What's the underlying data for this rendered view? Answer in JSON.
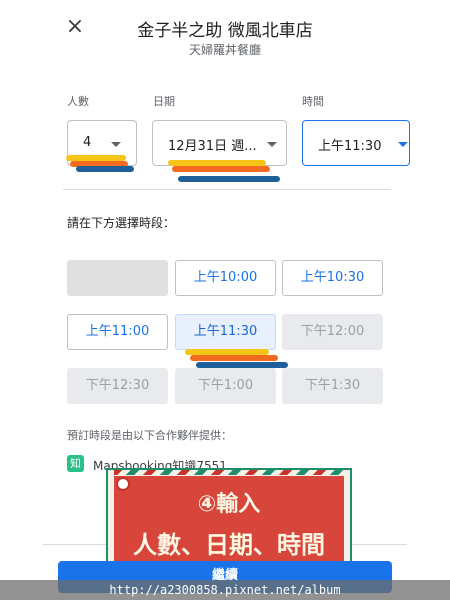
{
  "header": {
    "close_icon": "×",
    "title": "金子半之助 微風北車店",
    "subtitle": "天婦羅丼餐廳"
  },
  "booking": {
    "party_label": "人數",
    "party_value": "4",
    "date_label": "日期",
    "date_value": "12月31日 週...",
    "time_label": "時間",
    "time_value": "上午11:30"
  },
  "slots_heading": "請在下方選擇時段：",
  "slots": [
    {
      "label": "",
      "state": "empty"
    },
    {
      "label": "上午10:00",
      "state": "available"
    },
    {
      "label": "上午10:30",
      "state": "available"
    },
    {
      "label": "上午11:00",
      "state": "available"
    },
    {
      "label": "上午11:30",
      "state": "selected"
    },
    {
      "label": "下午12:00",
      "state": "unavailable"
    },
    {
      "label": "下午12:30",
      "state": "unavailable"
    },
    {
      "label": "下午1:00",
      "state": "unavailable"
    },
    {
      "label": "下午1:30",
      "state": "unavailable"
    }
  ],
  "provider": {
    "note": "預訂時段是由以下合作夥伴提供：",
    "logo_char": "知",
    "name": "Mapsbooking知識7551"
  },
  "promo": {
    "line1": "④輸入",
    "line2_a": "人數、",
    "line2_b": "日期",
    "line2_c": "、時間"
  },
  "footer": {
    "continue_label": "繼續"
  },
  "watermark": "http://a2300858.pixnet.net/album",
  "colors": {
    "accent": "#1a73e8",
    "promo_red": "#d8453b",
    "promo_green": "#1f8c6b",
    "marker_yellow": "#f5c518",
    "marker_orange": "#f26b21",
    "marker_blue": "#1f5f99"
  }
}
